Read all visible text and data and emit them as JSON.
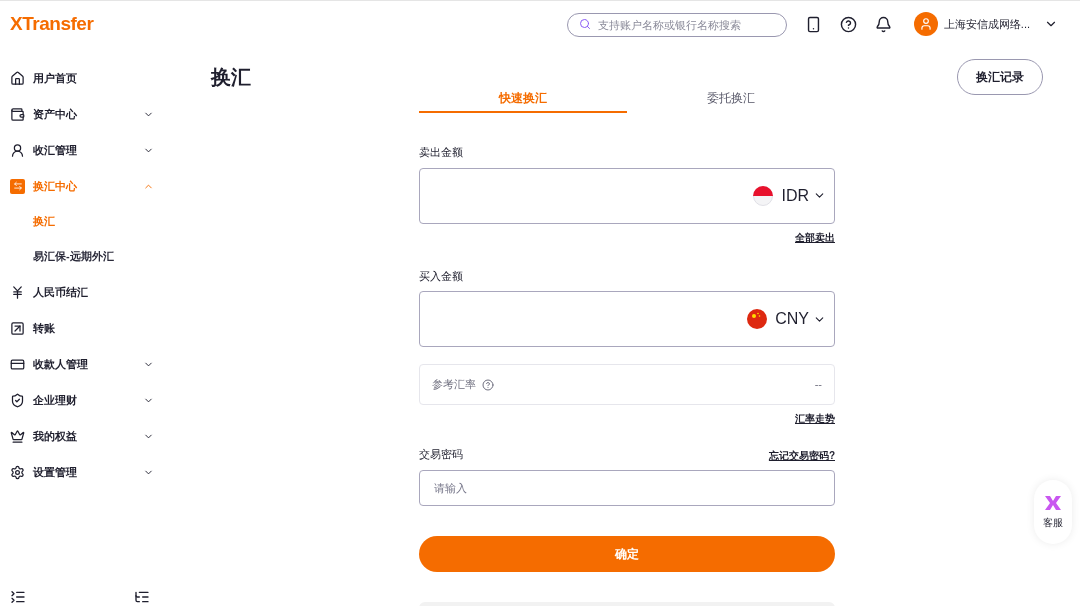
{
  "header": {
    "logo": "XTransfer",
    "search": {
      "placeholder": "支持账户名称或银行名称搜索"
    },
    "account": "上海安信成网络..."
  },
  "sidebar": {
    "items": [
      {
        "label": "用户首页",
        "selected": false
      },
      {
        "label": "资产中心",
        "selected": false,
        "expanded": false
      },
      {
        "label": "收汇管理",
        "selected": false,
        "expanded": false
      },
      {
        "label": "换汇中心",
        "selected": true,
        "expanded": true,
        "children": [
          {
            "label": "换汇",
            "selected": true
          },
          {
            "label": "易汇保-远期外汇",
            "selected": false
          }
        ]
      },
      {
        "label": "人民币结汇",
        "selected": false
      },
      {
        "label": "转账",
        "selected": false
      },
      {
        "label": "收款人管理",
        "selected": false,
        "expanded": false
      },
      {
        "label": "企业理财",
        "selected": false,
        "expanded": false
      },
      {
        "label": "我的权益",
        "selected": false,
        "expanded": false
      },
      {
        "label": "设置管理",
        "selected": false,
        "expanded": false
      }
    ]
  },
  "page": {
    "title": "换汇",
    "history_button": "换汇记录"
  },
  "tabs": [
    {
      "label": "快速换汇",
      "selected": true
    },
    {
      "label": "委托换汇",
      "selected": false
    }
  ],
  "form": {
    "sell": {
      "label": "卖出金额",
      "currency": "IDR",
      "link": "全部卖出"
    },
    "buy": {
      "label": "买入金额",
      "currency": "CNY"
    },
    "rate": {
      "label": "参考汇率",
      "value": "--",
      "link": "汇率走势"
    },
    "password": {
      "label": "交易密码",
      "link": "忘记交易密码?",
      "placeholder": "请输入"
    },
    "submit": "确定"
  },
  "support": {
    "label": "客服"
  }
}
